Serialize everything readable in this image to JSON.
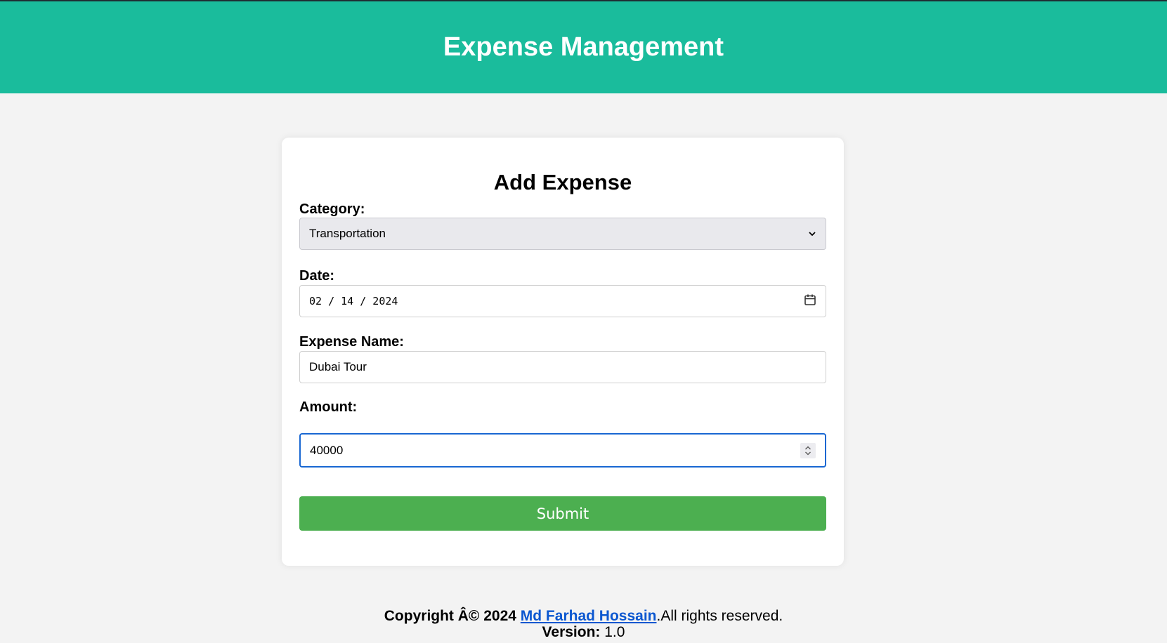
{
  "header": {
    "title": "Expense Management"
  },
  "form": {
    "title": "Add Expense",
    "category": {
      "label": "Category:",
      "value": "Transportation"
    },
    "date": {
      "label": "Date:",
      "value": "02 / 14 / 2024"
    },
    "expense_name": {
      "label": "Expense Name:",
      "value": "Dubai Tour"
    },
    "amount": {
      "label": "Amount:",
      "value": "40000"
    },
    "submit_label": "Submit"
  },
  "footer": {
    "copyright_prefix": "Copyright Â© 2024 ",
    "author_link": "Md Farhad Hossain",
    "rights": ".All rights reserved.",
    "version_label": "Version:",
    "version_value": " 1.0"
  },
  "colors": {
    "header_bg": "#1abc9c",
    "submit_bg": "#4caf50",
    "focus_border": "#1967d2",
    "link": "#0b57d0"
  },
  "icons": [
    "chevron-down-icon",
    "calendar-icon",
    "spinner-arrows-icon"
  ]
}
